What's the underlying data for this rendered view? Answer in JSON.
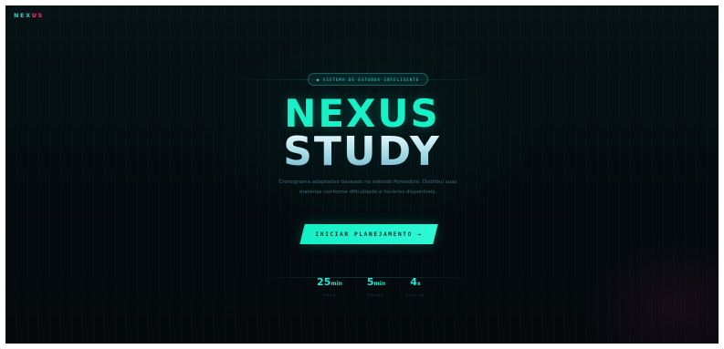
{
  "brand": {
    "logo_part1": "NEX",
    "logo_part2": "US",
    "color_primary": "#18f0c8",
    "color_accent": "#ff2e7a"
  },
  "hero": {
    "badge": "● SISTEMA DE ESTUDOS INTELIGENTE",
    "title_line1": "NEXUS",
    "title_line2": "STUDY",
    "description": "Cronograma adaptativo baseado no método Pomodoro. Distribui suas matérias conforme dificuldade e horários disponíveis.",
    "cta_label": "INICIAR PLANEJAMENTO →"
  },
  "stats": [
    {
      "value": "25",
      "unit": "min",
      "label": "FOCO"
    },
    {
      "value": "5",
      "unit": "min",
      "label": "PAUSA"
    },
    {
      "value": "4",
      "unit": "x",
      "label": "CICLOS"
    }
  ]
}
